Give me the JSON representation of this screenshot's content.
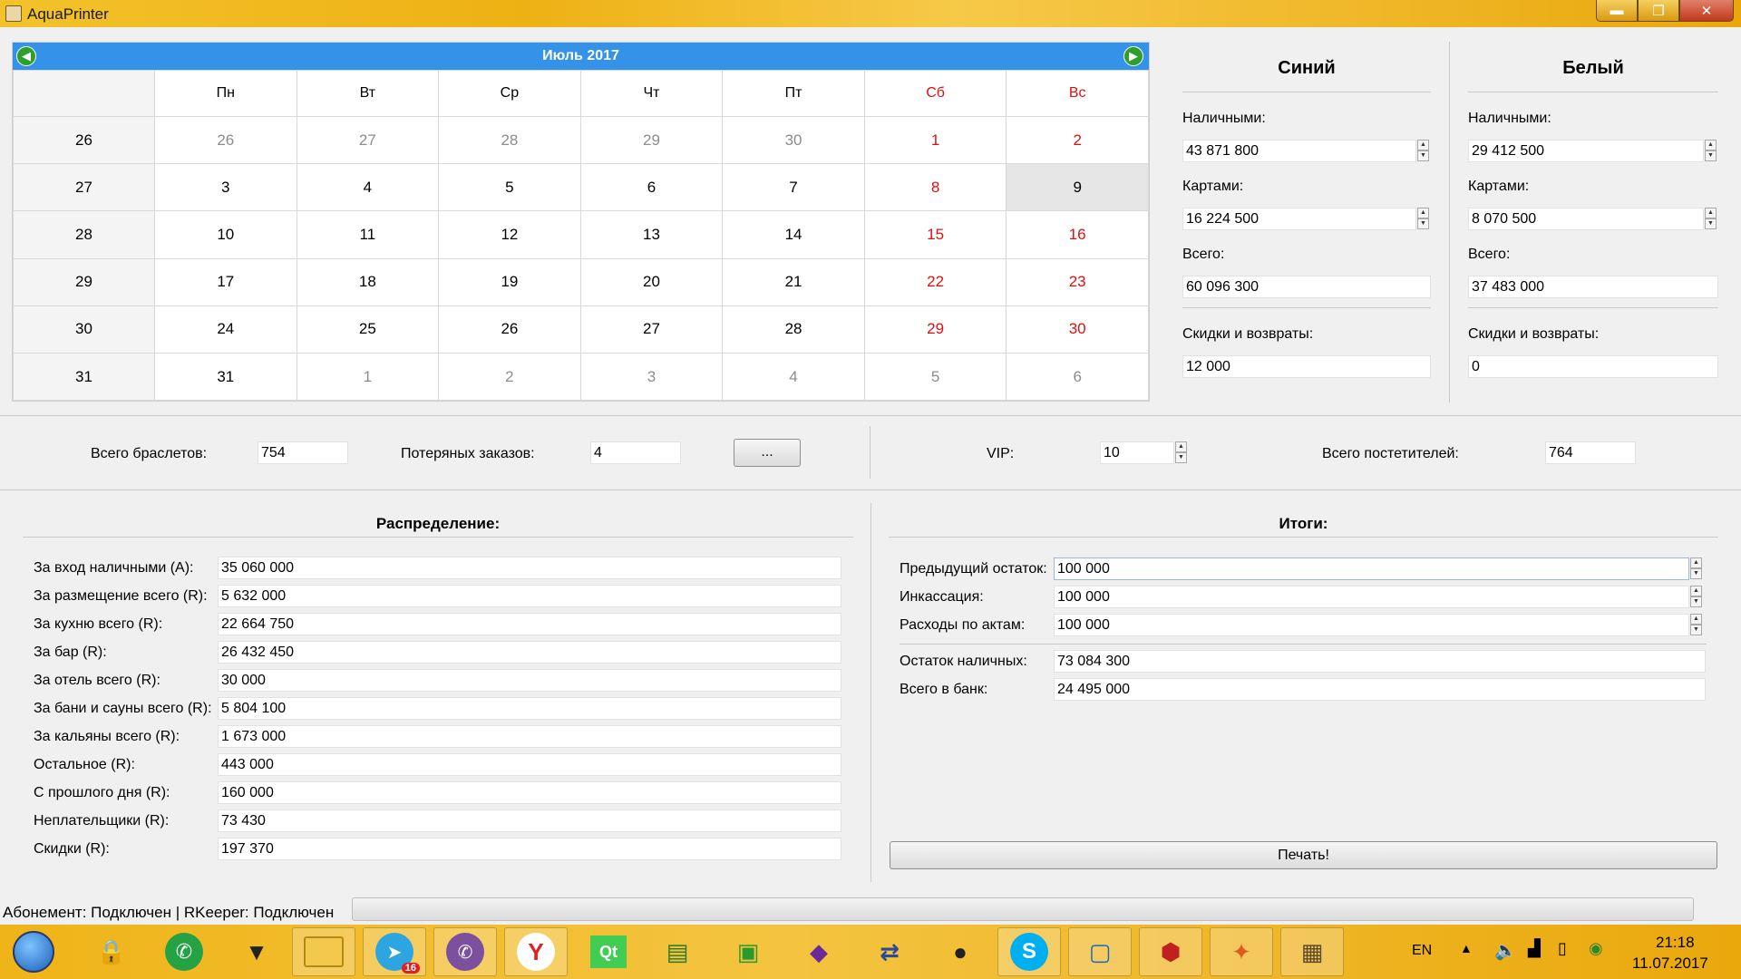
{
  "window": {
    "title": "AquaPrinter",
    "min_label": "▬",
    "max_label": "❐",
    "close_label": "✕"
  },
  "calendar": {
    "month_year": "Июль  2017",
    "weekdays": [
      "Пн",
      "Вт",
      "Ср",
      "Чт",
      "Пт",
      "Сб",
      "Вс"
    ],
    "rows": [
      {
        "week": "26",
        "days": [
          "26",
          "27",
          "28",
          "29",
          "30",
          "1",
          "2"
        ]
      },
      {
        "week": "27",
        "days": [
          "3",
          "4",
          "5",
          "6",
          "7",
          "8",
          "9"
        ]
      },
      {
        "week": "28",
        "days": [
          "10",
          "11",
          "12",
          "13",
          "14",
          "15",
          "16"
        ]
      },
      {
        "week": "29",
        "days": [
          "17",
          "18",
          "19",
          "20",
          "21",
          "22",
          "23"
        ]
      },
      {
        "week": "30",
        "days": [
          "24",
          "25",
          "26",
          "27",
          "28",
          "29",
          "30"
        ]
      },
      {
        "week": "31",
        "days": [
          "31",
          "1",
          "2",
          "3",
          "4",
          "5",
          "6"
        ]
      }
    ],
    "selected_day": "9"
  },
  "blue": {
    "title": "Синий",
    "cash_label": "Наличными:",
    "cash": "43 871 800",
    "cards_label": "Картами:",
    "cards": "16 224 500",
    "total_label": "Всего:",
    "total": "60 096 300",
    "discounts_label": "Скидки и возвраты:",
    "discounts": "12 000"
  },
  "white": {
    "title": "Белый",
    "cash_label": "Наличными:",
    "cash": "29 412 500",
    "cards_label": "Картами:",
    "cards": "8 070 500",
    "total_label": "Всего:",
    "total": "37 483 000",
    "discounts_label": "Скидки и возвраты:",
    "discounts": "0"
  },
  "middle": {
    "bracelets_label": "Всего браслетов:",
    "bracelets": "754",
    "lost_label": "Потеряных заказов:",
    "lost": "4",
    "more_label": "...",
    "vip_label": "VIP:",
    "vip": "10",
    "visitors_label": "Всего постетителей:",
    "visitors": "764"
  },
  "distribution": {
    "title": "Распределение:",
    "rows": [
      {
        "label": "За вход наличными (А):",
        "value": "35 060 000"
      },
      {
        "label": "За размещение всего (R):",
        "value": "5 632 000"
      },
      {
        "label": "За кухню всего (R):",
        "value": "22 664 750"
      },
      {
        "label": "За бар (R):",
        "value": "26 432 450"
      },
      {
        "label": "За отель всего (R):",
        "value": "30 000"
      },
      {
        "label": "За бани и сауны всего (R):",
        "value": "5 804 100"
      },
      {
        "label": "За кальяны всего (R):",
        "value": "1 673 000"
      },
      {
        "label": "Остальное (R):",
        "value": "443 000"
      },
      {
        "label": "С прошлого дня (R):",
        "value": "160 000"
      },
      {
        "label": "Неплательщики (R):",
        "value": "73 430"
      },
      {
        "label": "Скидки (R):",
        "value": "197 370"
      }
    ]
  },
  "totals": {
    "title": "Итоги:",
    "prev_label": "Предыдущий остаток:",
    "prev": "100 000",
    "collection_label": "Инкассация:",
    "collection": "100 000",
    "acts_label": "Расходы по актам:",
    "acts": "100 000",
    "cash_left_label": "Остаток наличных:",
    "cash_left": "73 084 300",
    "bank_label": "Всего в банк:",
    "bank": "24 495 000",
    "print_label": "Печать!"
  },
  "status": {
    "text": "Абонемент: Подключен | RKeeper: Подключен"
  },
  "taskbar": {
    "lang": "EN",
    "time": "21:18",
    "date": "11.07.2017",
    "telegram_badge": "16"
  }
}
